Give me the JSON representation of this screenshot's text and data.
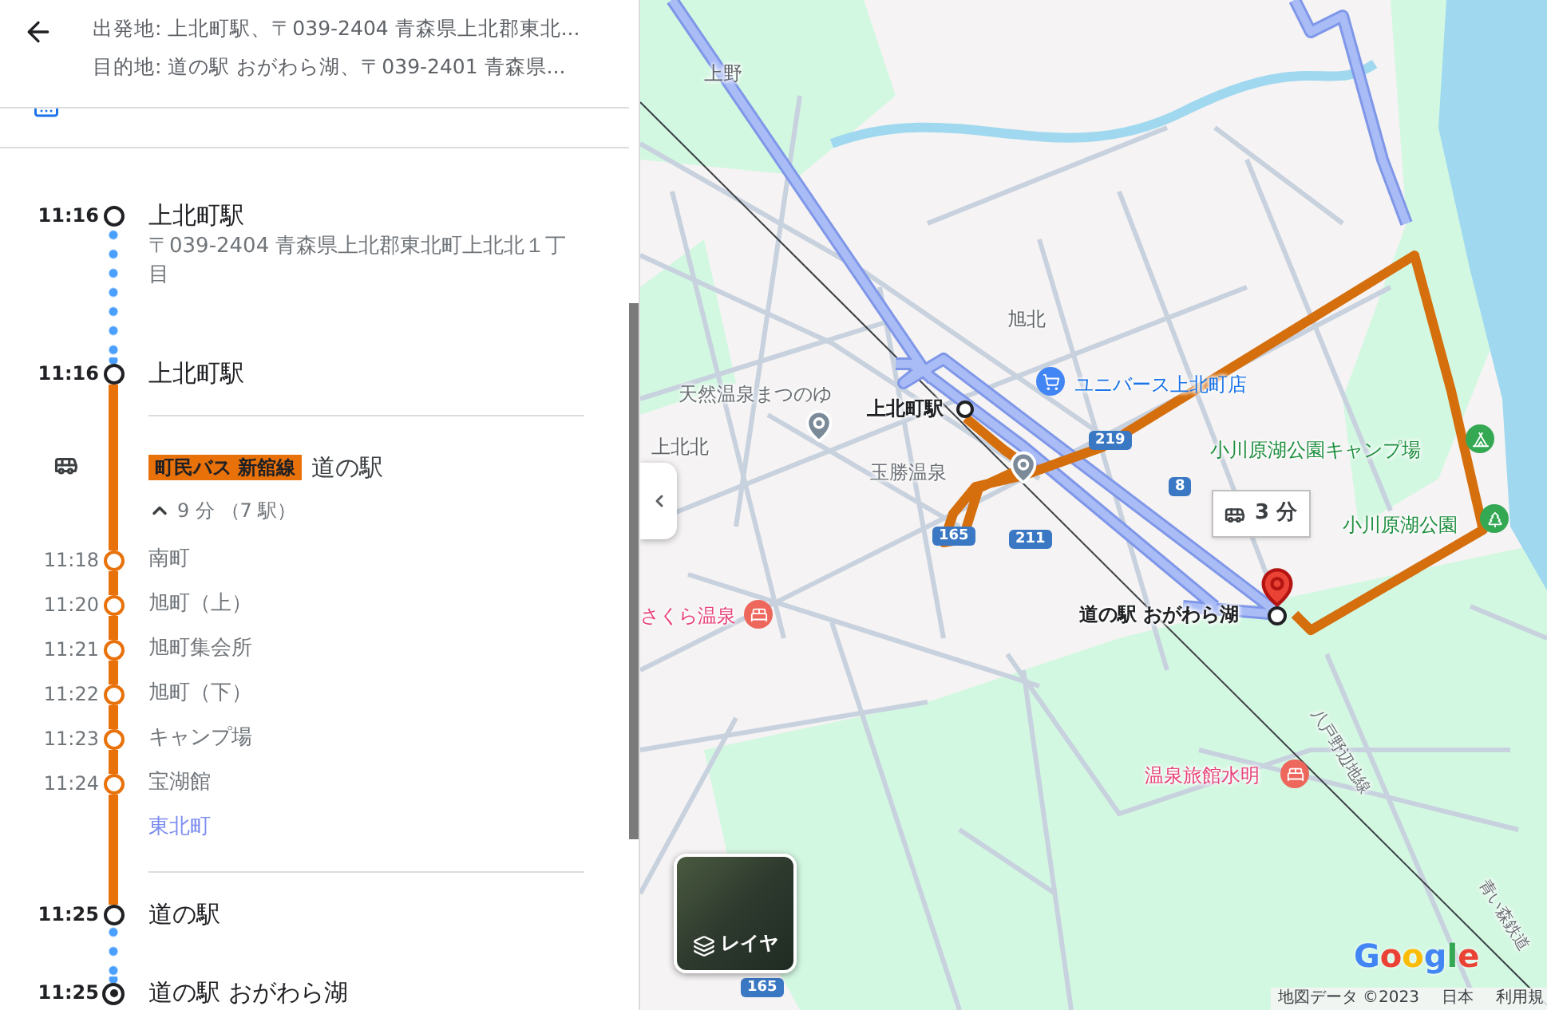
{
  "header": {
    "origin": "出発地: 上北町駅、〒039-2404 青森県上北郡東北...",
    "destination": "目的地: 道の駅 おがわら湖、〒039-2401 青森県..."
  },
  "itinerary": [
    {
      "kind": "origin",
      "time": "11:16",
      "name": "上北町駅",
      "address": "〒039-2404 青森県上北郡東北町上北北１丁目"
    },
    {
      "kind": "board",
      "time": "11:16",
      "name": "上北町駅"
    },
    {
      "kind": "transit",
      "line": "町民バス 新舘線",
      "color": "#e8710a",
      "headsign": "道の駅",
      "duration": "9 分 （7 駅）",
      "expanded": true,
      "stops": [
        {
          "time": "11:18",
          "name": "南町"
        },
        {
          "time": "11:20",
          "name": "旭町（上）"
        },
        {
          "time": "11:21",
          "name": "旭町集会所"
        },
        {
          "time": "11:22",
          "name": "旭町（下）"
        },
        {
          "time": "11:23",
          "name": "キャンプ場"
        },
        {
          "time": "11:24",
          "name": "宝湖館"
        }
      ],
      "last_stop": "東北町"
    },
    {
      "kind": "alight",
      "time": "11:25",
      "name": "道の駅"
    },
    {
      "kind": "destination",
      "time": "11:25",
      "name": "道の駅 おがわら湖"
    }
  ],
  "map": {
    "labels": [
      {
        "kind": "area",
        "text": "上野"
      },
      {
        "kind": "area",
        "text": "旭北"
      },
      {
        "kind": "poi",
        "text": "天然温泉まつのゆ"
      },
      {
        "kind": "area",
        "text": "上北北"
      },
      {
        "kind": "station",
        "text": "上北町駅"
      },
      {
        "kind": "poi",
        "text": "玉勝温泉"
      },
      {
        "kind": "shop",
        "text": "ユニバース上北町店"
      },
      {
        "kind": "park",
        "text": "小川原湖公園キャンプ場"
      },
      {
        "kind": "park",
        "text": "小川原湖公園"
      },
      {
        "kind": "lodging",
        "text": "さくら温泉"
      },
      {
        "kind": "station",
        "text": "道の駅 おがわら湖"
      },
      {
        "kind": "lodging",
        "text": "温泉旅館水明"
      },
      {
        "kind": "road",
        "text": "八戸野辺地線"
      },
      {
        "kind": "road",
        "text": "青い森鉄道"
      }
    ],
    "shields": [
      "219",
      "8",
      "165",
      "211",
      "165"
    ],
    "duration_callout": "3 分",
    "layers_button": "レイヤ",
    "logo": "Google",
    "footer": [
      "地図データ ©2023",
      "日本",
      "利用規"
    ]
  }
}
